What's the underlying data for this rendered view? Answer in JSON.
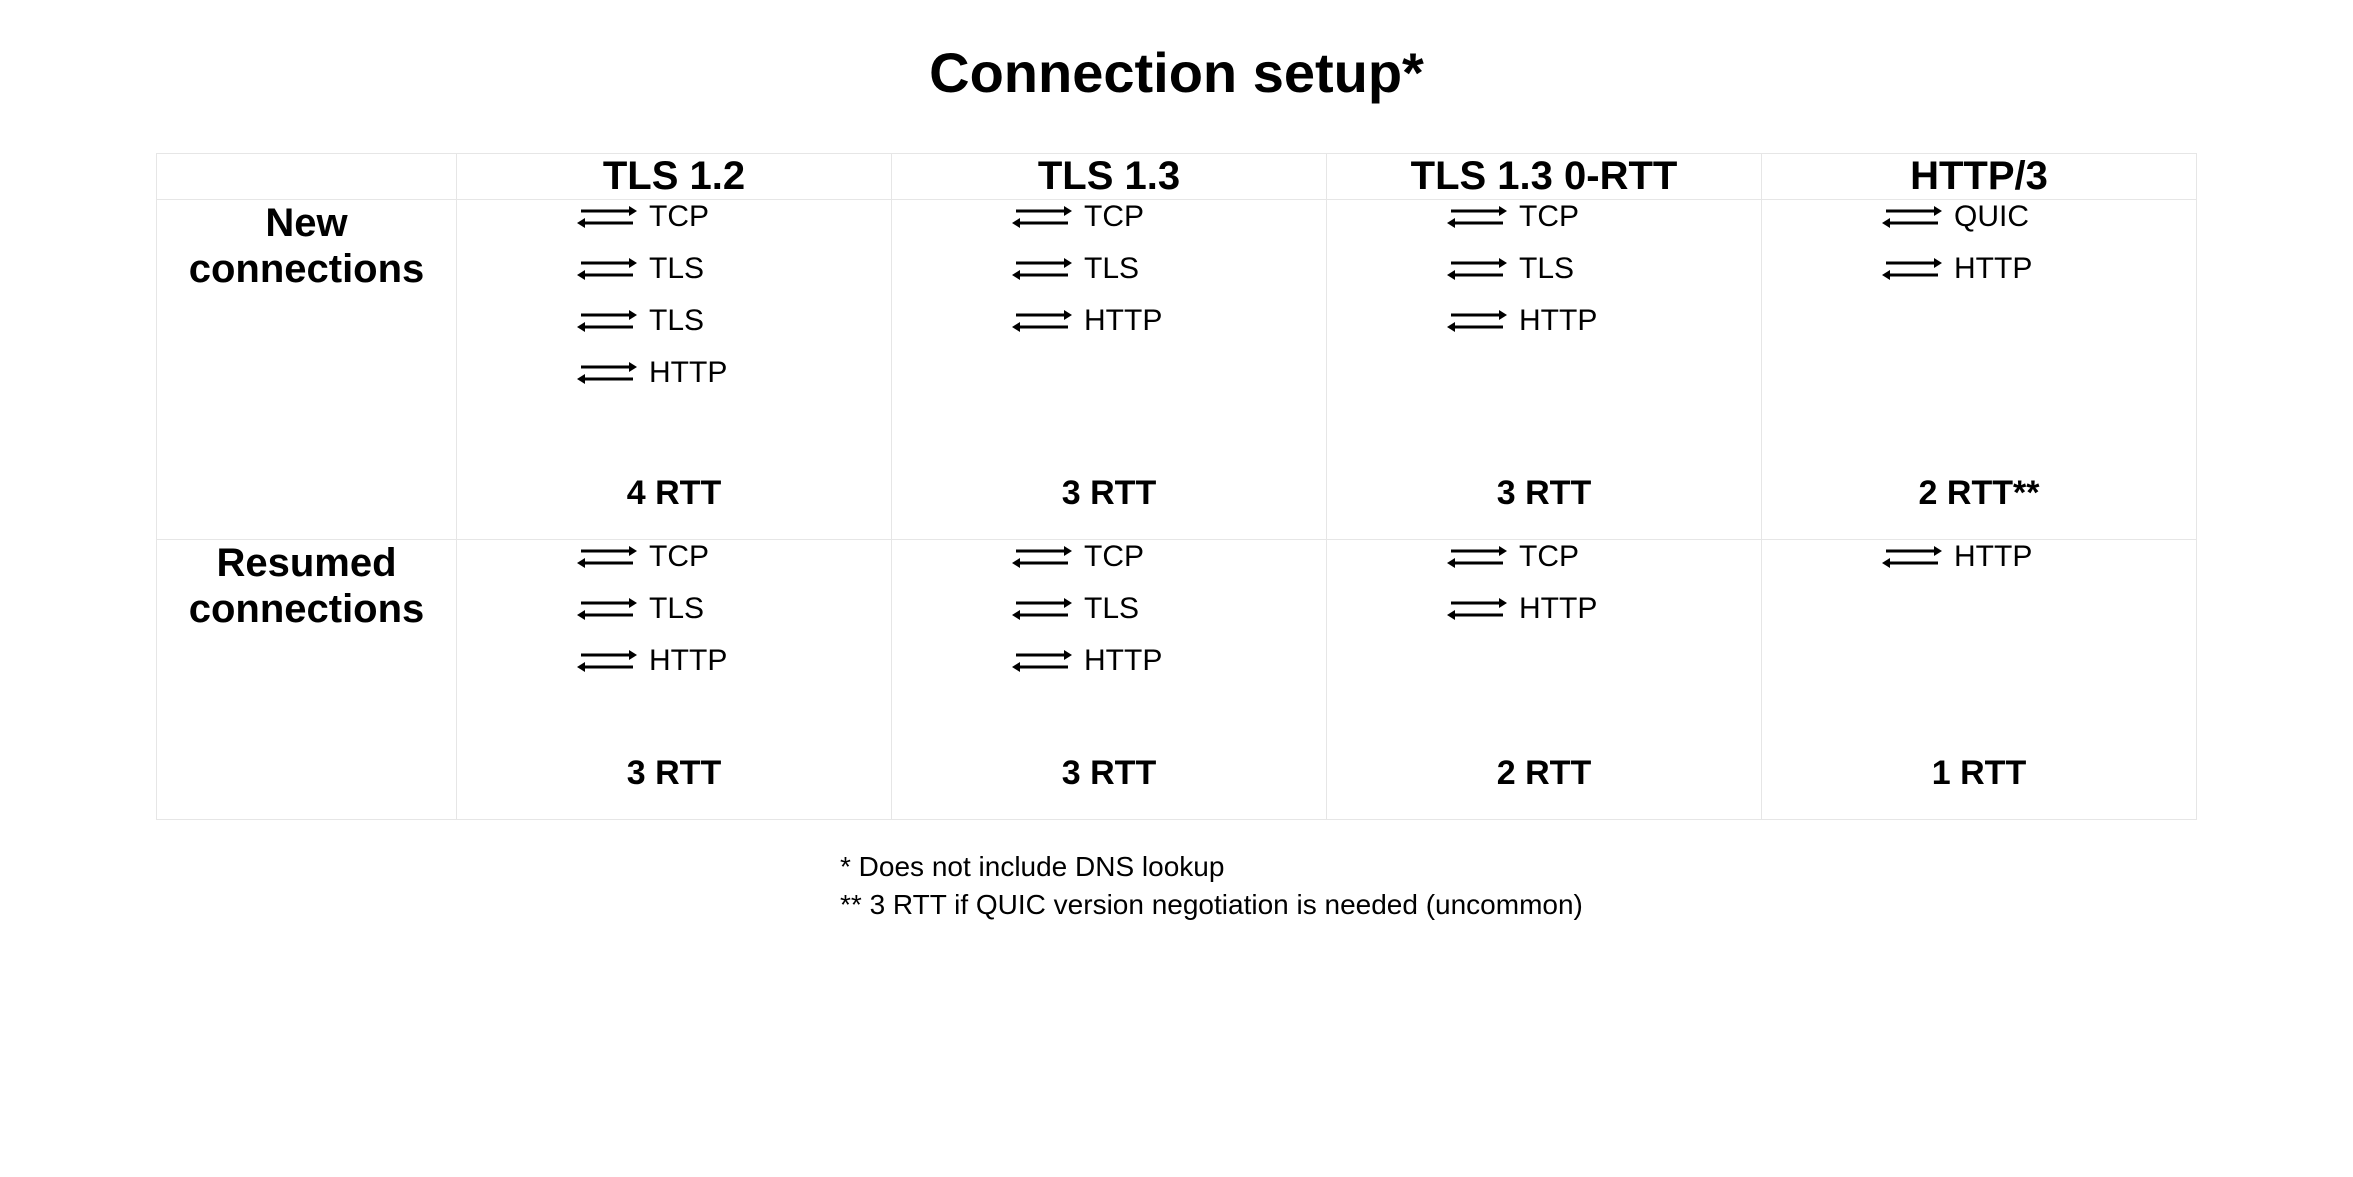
{
  "title": "Connection setup*",
  "columns": [
    "TLS 1.2",
    "TLS 1.3",
    "TLS 1.3 0-RTT",
    "HTTP/3"
  ],
  "rows": {
    "new": {
      "label_line1": "New",
      "label_line2": "connections",
      "cells": [
        {
          "steps": [
            "TCP",
            "TLS",
            "TLS",
            "HTTP"
          ],
          "rtt": "4 RTT"
        },
        {
          "steps": [
            "TCP",
            "TLS",
            "HTTP"
          ],
          "rtt": "3 RTT"
        },
        {
          "steps": [
            "TCP",
            "TLS",
            "HTTP"
          ],
          "rtt": "3 RTT"
        },
        {
          "steps": [
            "QUIC",
            "HTTP"
          ],
          "rtt": "2 RTT**"
        }
      ]
    },
    "resumed": {
      "label_line1": "Resumed",
      "label_line2": "connections",
      "cells": [
        {
          "steps": [
            "TCP",
            "TLS",
            "HTTP"
          ],
          "rtt": "3 RTT"
        },
        {
          "steps": [
            "TCP",
            "TLS",
            "HTTP"
          ],
          "rtt": "3 RTT"
        },
        {
          "steps": [
            "TCP",
            "HTTP"
          ],
          "rtt": "2 RTT"
        },
        {
          "steps": [
            "HTTP"
          ],
          "rtt": "1 RTT"
        }
      ]
    }
  },
  "footnotes": [
    "* Does not include DNS lookup",
    "** 3 RTT if QUIC version negotiation is needed (uncommon)"
  ]
}
